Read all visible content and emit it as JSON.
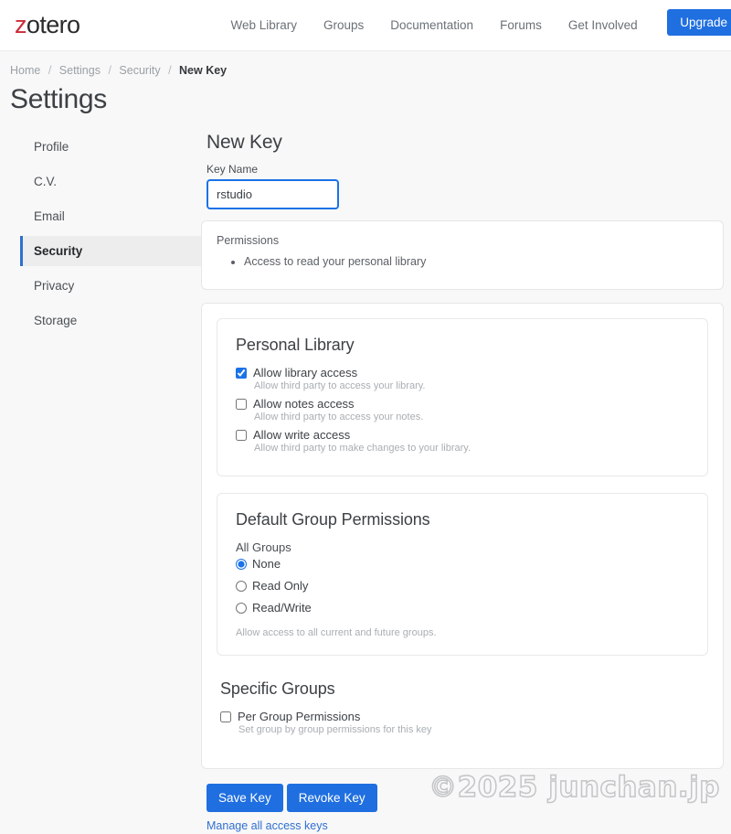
{
  "header": {
    "brand_first_letter": "z",
    "brand_rest": "otero",
    "nav_links": [
      {
        "label": "Web Library"
      },
      {
        "label": "Groups"
      },
      {
        "label": "Documentation"
      },
      {
        "label": "Forums"
      },
      {
        "label": "Get Involved"
      }
    ],
    "upgrade_label": "Upgrade"
  },
  "breadcrumb": {
    "items": [
      {
        "label": "Home"
      },
      {
        "label": "Settings"
      },
      {
        "label": "Security"
      }
    ],
    "current": "New Key",
    "separator": "/"
  },
  "page_title": "Settings",
  "sidebar": {
    "items": [
      {
        "label": "Profile",
        "active": false
      },
      {
        "label": "C.V.",
        "active": false
      },
      {
        "label": "Email",
        "active": false
      },
      {
        "label": "Security",
        "active": true
      },
      {
        "label": "Privacy",
        "active": false
      },
      {
        "label": "Storage",
        "active": false
      }
    ]
  },
  "main": {
    "section_title": "New Key",
    "key_name": {
      "label": "Key Name",
      "value": "rstudio",
      "placeholder": ""
    },
    "permissions_card": {
      "label": "Permissions",
      "items": [
        "Access to read your personal library"
      ]
    },
    "personal_library": {
      "title": "Personal Library",
      "options": [
        {
          "label": "Allow library access",
          "hint": "Allow third party to access your library.",
          "checked": true
        },
        {
          "label": "Allow notes access",
          "hint": "Allow third party to access your notes.",
          "checked": false
        },
        {
          "label": "Allow write access",
          "hint": "Allow third party to make changes to your library.",
          "checked": false
        }
      ]
    },
    "default_group_permissions": {
      "title": "Default Group Permissions",
      "group_label": "All Groups",
      "options": [
        {
          "label": "None",
          "selected": true
        },
        {
          "label": "Read Only",
          "selected": false
        },
        {
          "label": "Read/Write",
          "selected": false
        }
      ],
      "note": "Allow access to all current and future groups."
    },
    "specific_groups": {
      "title": "Specific Groups",
      "option": {
        "label": "Per Group Permissions",
        "hint": "Set group by group permissions for this key",
        "checked": false
      }
    },
    "actions": {
      "save_label": "Save Key",
      "revoke_label": "Revoke Key",
      "manage_link_label": "Manage all access keys"
    }
  },
  "watermark": "©2025 junchan.jp",
  "colors": {
    "accent_blue": "#1f6fe0",
    "brand_red": "#cc2936",
    "link_blue": "#2f6fd0",
    "page_bg": "#f8f8f8"
  }
}
